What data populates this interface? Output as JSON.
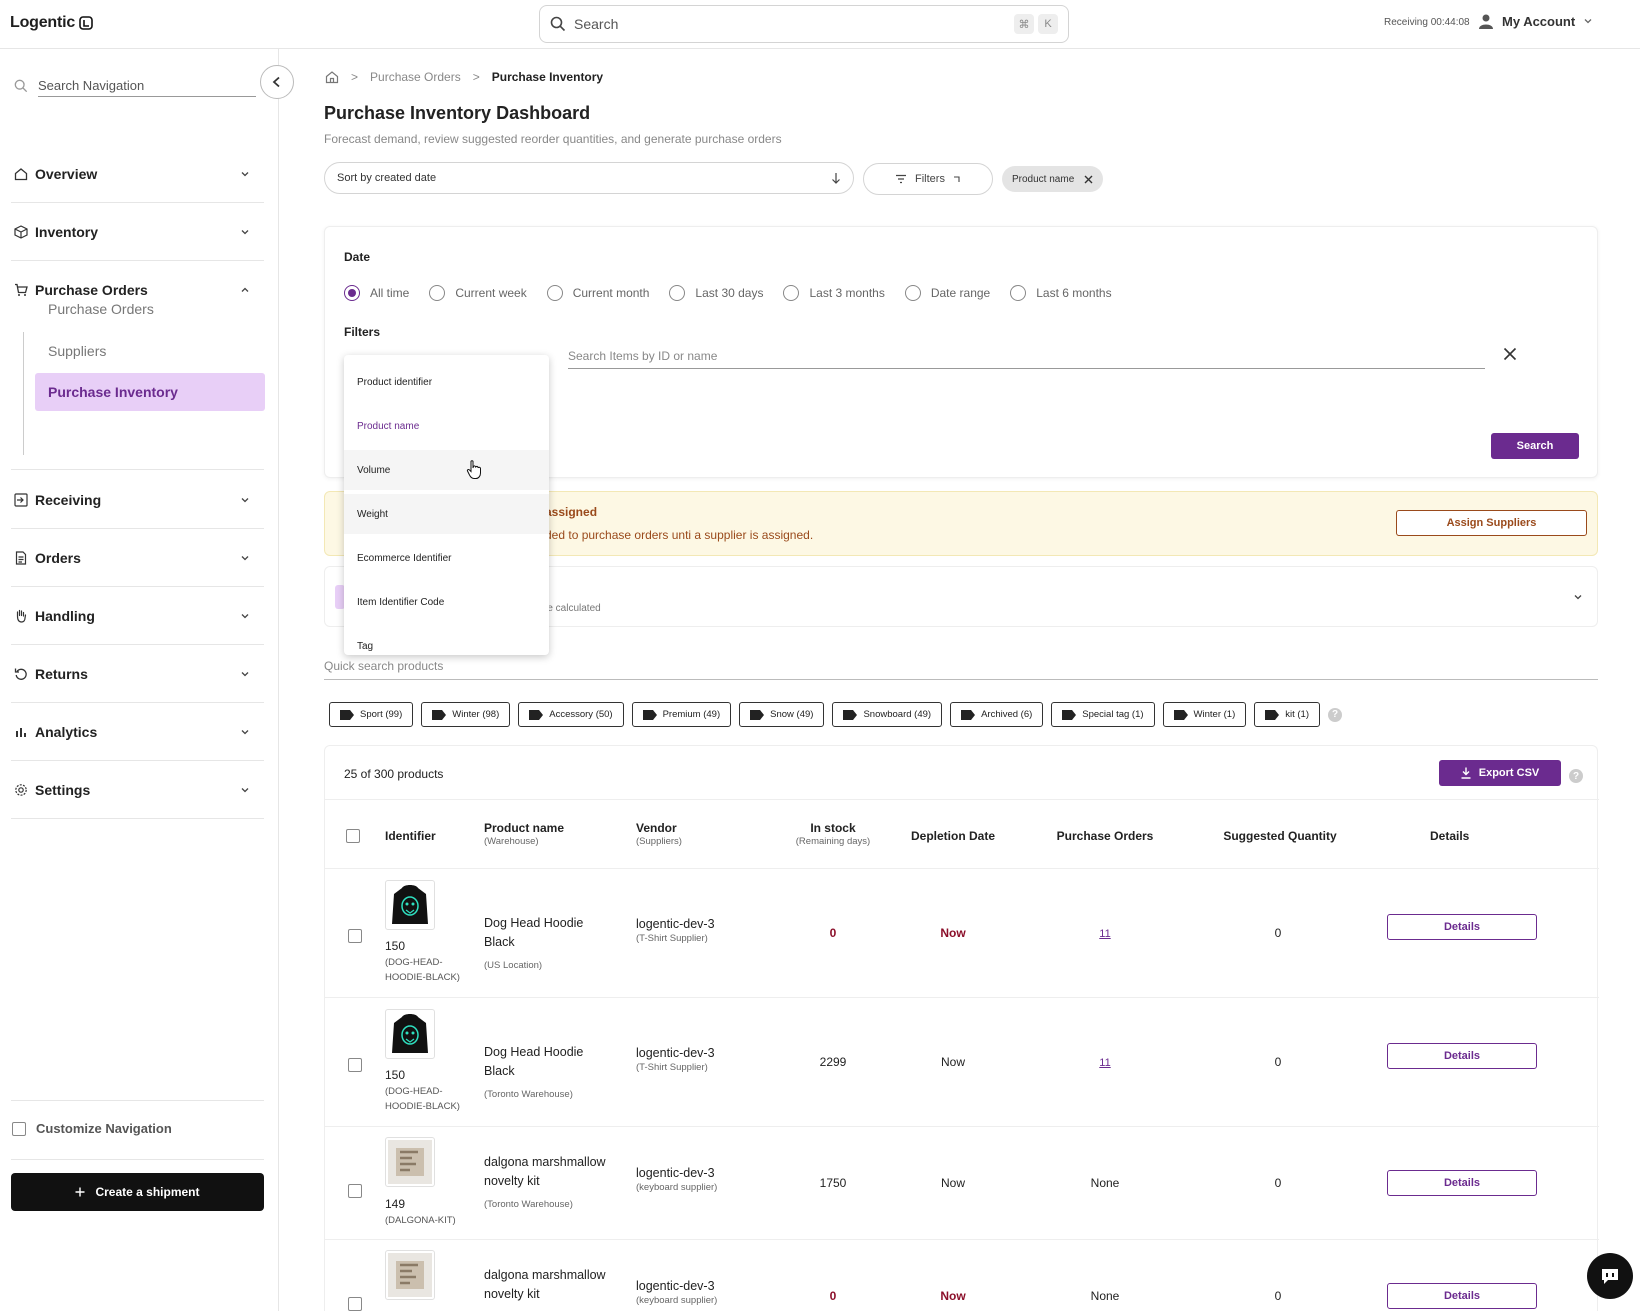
{
  "app": {
    "logo": "Logentic"
  },
  "topbar": {
    "search_placeholder": "Search",
    "kbd_cmd": "⌘",
    "kbd_k": "K",
    "receiving_timer": "Receiving 00:44:08",
    "account_label": "My Account"
  },
  "sidebar": {
    "search_placeholder": "Search Navigation",
    "sections": [
      {
        "label": "Overview",
        "icon": "home-icon"
      },
      {
        "label": "Inventory",
        "icon": "box-icon"
      },
      {
        "label": "Purchase Orders",
        "icon": "cart-icon",
        "expanded": true
      },
      {
        "label": "Receiving",
        "icon": "receiving-icon"
      },
      {
        "label": "Orders",
        "icon": "document-icon"
      },
      {
        "label": "Handling",
        "icon": "hand-icon"
      },
      {
        "label": "Returns",
        "icon": "return-icon"
      },
      {
        "label": "Analytics",
        "icon": "analytics-icon"
      },
      {
        "label": "Settings",
        "icon": "gear-icon"
      }
    ],
    "subitems": [
      "Purchase Orders",
      "Suppliers",
      "Purchase Inventory"
    ],
    "customize_label": "Customize Navigation",
    "create_label": "Create a shipment"
  },
  "breadcrumb": {
    "parent": "Purchase Orders",
    "current": "Purchase Inventory"
  },
  "page": {
    "title": "Purchase Inventory Dashboard",
    "subtitle": "Forecast demand, review suggested reorder quantities, and generate purchase orders"
  },
  "toolbar": {
    "sort_value": "Sort by created date",
    "filters_label": "Filters",
    "active_chip": "Product name"
  },
  "filter_panel": {
    "date_label": "Date",
    "date_options": [
      "All time",
      "Current week",
      "Current month",
      "Last 30 days",
      "Last 3 months",
      "Date range",
      "Last 6 months"
    ],
    "date_selected": "All time",
    "filters_label": "Filters",
    "item_search_placeholder": "Search Items by ID or name",
    "search_button": "Search"
  },
  "dropdown": {
    "options": [
      "Product identifier",
      "Product name",
      "Volume",
      "Weight",
      "Ecommerce Identifier",
      "Item Identifier Code",
      "Tag"
    ],
    "selected": "Product name",
    "hovered": "Volume"
  },
  "warning": {
    "title_visible": "assigned",
    "text_visible": "ded to purchase orders unti a supplier is assigned.",
    "button": "Assign Suppliers"
  },
  "collapse_panel": {
    "text_visible": "re calculated"
  },
  "quick_search_placeholder": "Quick search products",
  "tags": [
    "Sport (99)",
    "Winter (98)",
    "Accessory (50)",
    "Premium (49)",
    "Snow (49)",
    "Snowboard (49)",
    "Archived (6)",
    "Special tag (1)",
    "Winter (1)",
    "kit (1)"
  ],
  "table": {
    "count": "25 of 300 products",
    "export_label": "Export CSV",
    "columns": {
      "identifier": "Identifier",
      "product": "Product name",
      "product_sub": "(Warehouse)",
      "vendor": "Vendor",
      "vendor_sub": "(Suppliers)",
      "stock": "In stock",
      "stock_sub": "(Remaining days)",
      "depletion": "Depletion Date",
      "pos": "Purchase Orders",
      "suggested": "Suggested Quantity",
      "details": "Details"
    },
    "details_label": "Details",
    "rows": [
      {
        "id": "150",
        "sku": "(DOG-HEAD-HOODIE-BLACK)",
        "name": "Dog Head Hoodie Black",
        "warehouse": "(US Location)",
        "vendor": "logentic-dev-3",
        "supplier": "(T-Shirt Supplier)",
        "stock": "0",
        "depletion": "Now",
        "pos": "11",
        "suggested": "0",
        "alert": true,
        "image": "hoodie"
      },
      {
        "id": "150",
        "sku": "(DOG-HEAD-HOODIE-BLACK)",
        "name": "Dog Head Hoodie Black",
        "warehouse": "(Toronto Warehouse)",
        "vendor": "logentic-dev-3",
        "supplier": "(T-Shirt Supplier)",
        "stock": "2299",
        "depletion": "Now",
        "pos": "11",
        "suggested": "0",
        "alert": false,
        "image": "hoodie"
      },
      {
        "id": "149",
        "sku": "(DALGONA-KIT)",
        "name": "dalgona marshmallow novelty kit",
        "warehouse": "(Toronto Warehouse)",
        "vendor": "logentic-dev-3",
        "supplier": "(keyboard supplier)",
        "stock": "1750",
        "depletion": "Now",
        "pos": "None",
        "suggested": "0",
        "alert": false,
        "image": "kit"
      },
      {
        "id": "",
        "sku": "",
        "name": "dalgona marshmallow novelty kit",
        "warehouse": "",
        "vendor": "logentic-dev-3",
        "supplier": "(keyboard supplier)",
        "stock": "0",
        "depletion": "Now",
        "pos": "None",
        "suggested": "0",
        "alert": true,
        "image": "kit"
      }
    ]
  },
  "colors": {
    "accent": "#6b2b8f",
    "accent_light": "#e8cff7",
    "danger": "#8b0f2a",
    "warning_bg": "#fdf8e4",
    "warning_text": "#9a4a1b"
  }
}
